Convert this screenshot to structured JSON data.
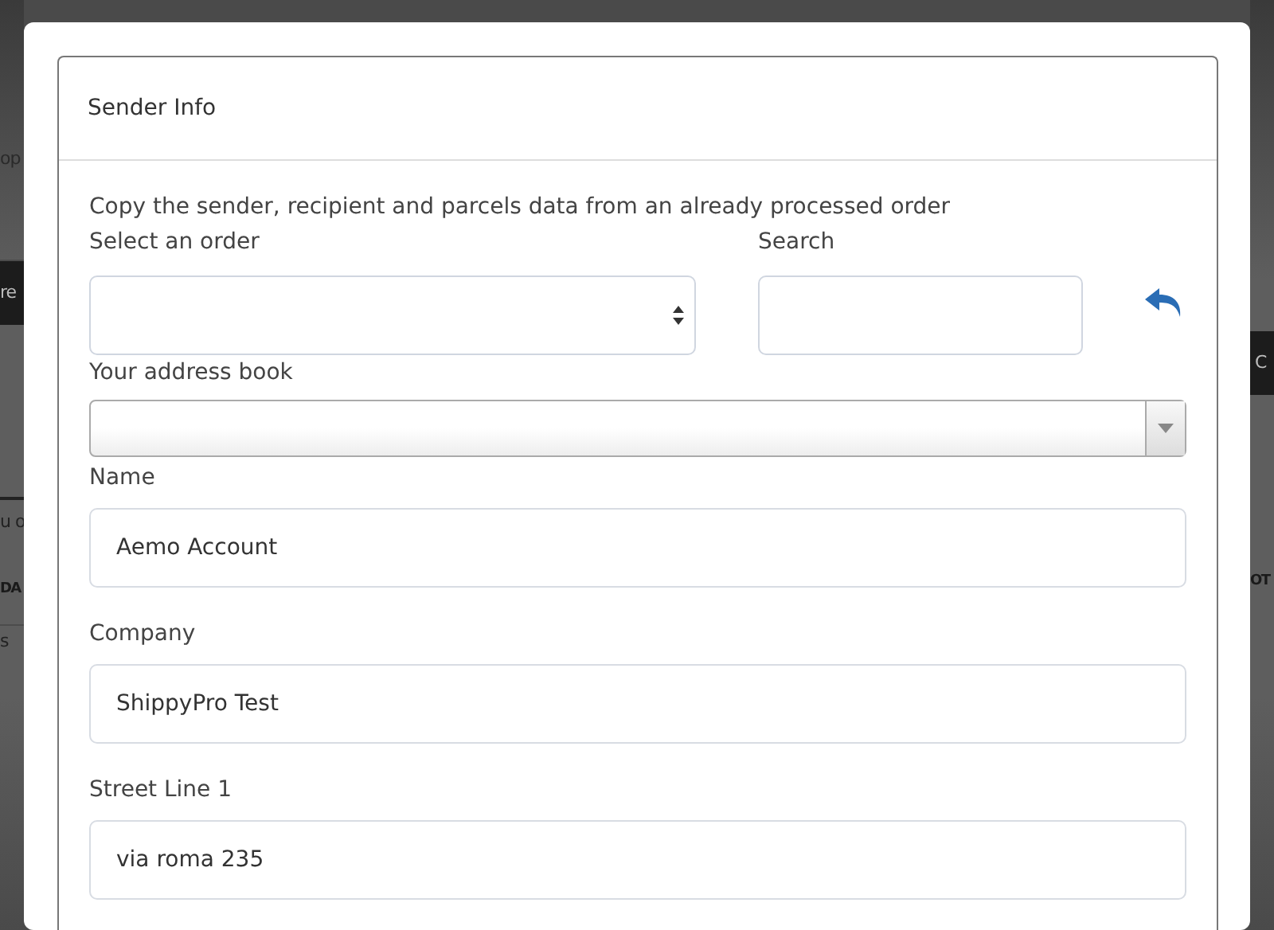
{
  "background": {
    "left": [
      {
        "kind": "text",
        "text": "op"
      },
      {
        "kind": "button",
        "text": "re"
      },
      {
        "kind": "text",
        "text": "u o"
      },
      {
        "kind": "heading",
        "text": "DA"
      },
      {
        "kind": "text",
        "text": "s"
      }
    ],
    "right": [
      {
        "kind": "button",
        "text": "C"
      },
      {
        "kind": "heading",
        "text": "OT"
      }
    ]
  },
  "modal": {
    "panel_title": "Sender Info",
    "intro": "Copy the sender, recipient and parcels data from an already processed order",
    "order_select": {
      "label": "Select an order"
    },
    "search": {
      "label": "Search"
    },
    "address_book": {
      "label": "Your address book"
    },
    "fields": [
      {
        "label": "Name",
        "value": "Aemo Account"
      },
      {
        "label": "Company",
        "value": "ShippyPro Test"
      },
      {
        "label": "Street Line 1",
        "value": "via roma 235"
      }
    ]
  }
}
